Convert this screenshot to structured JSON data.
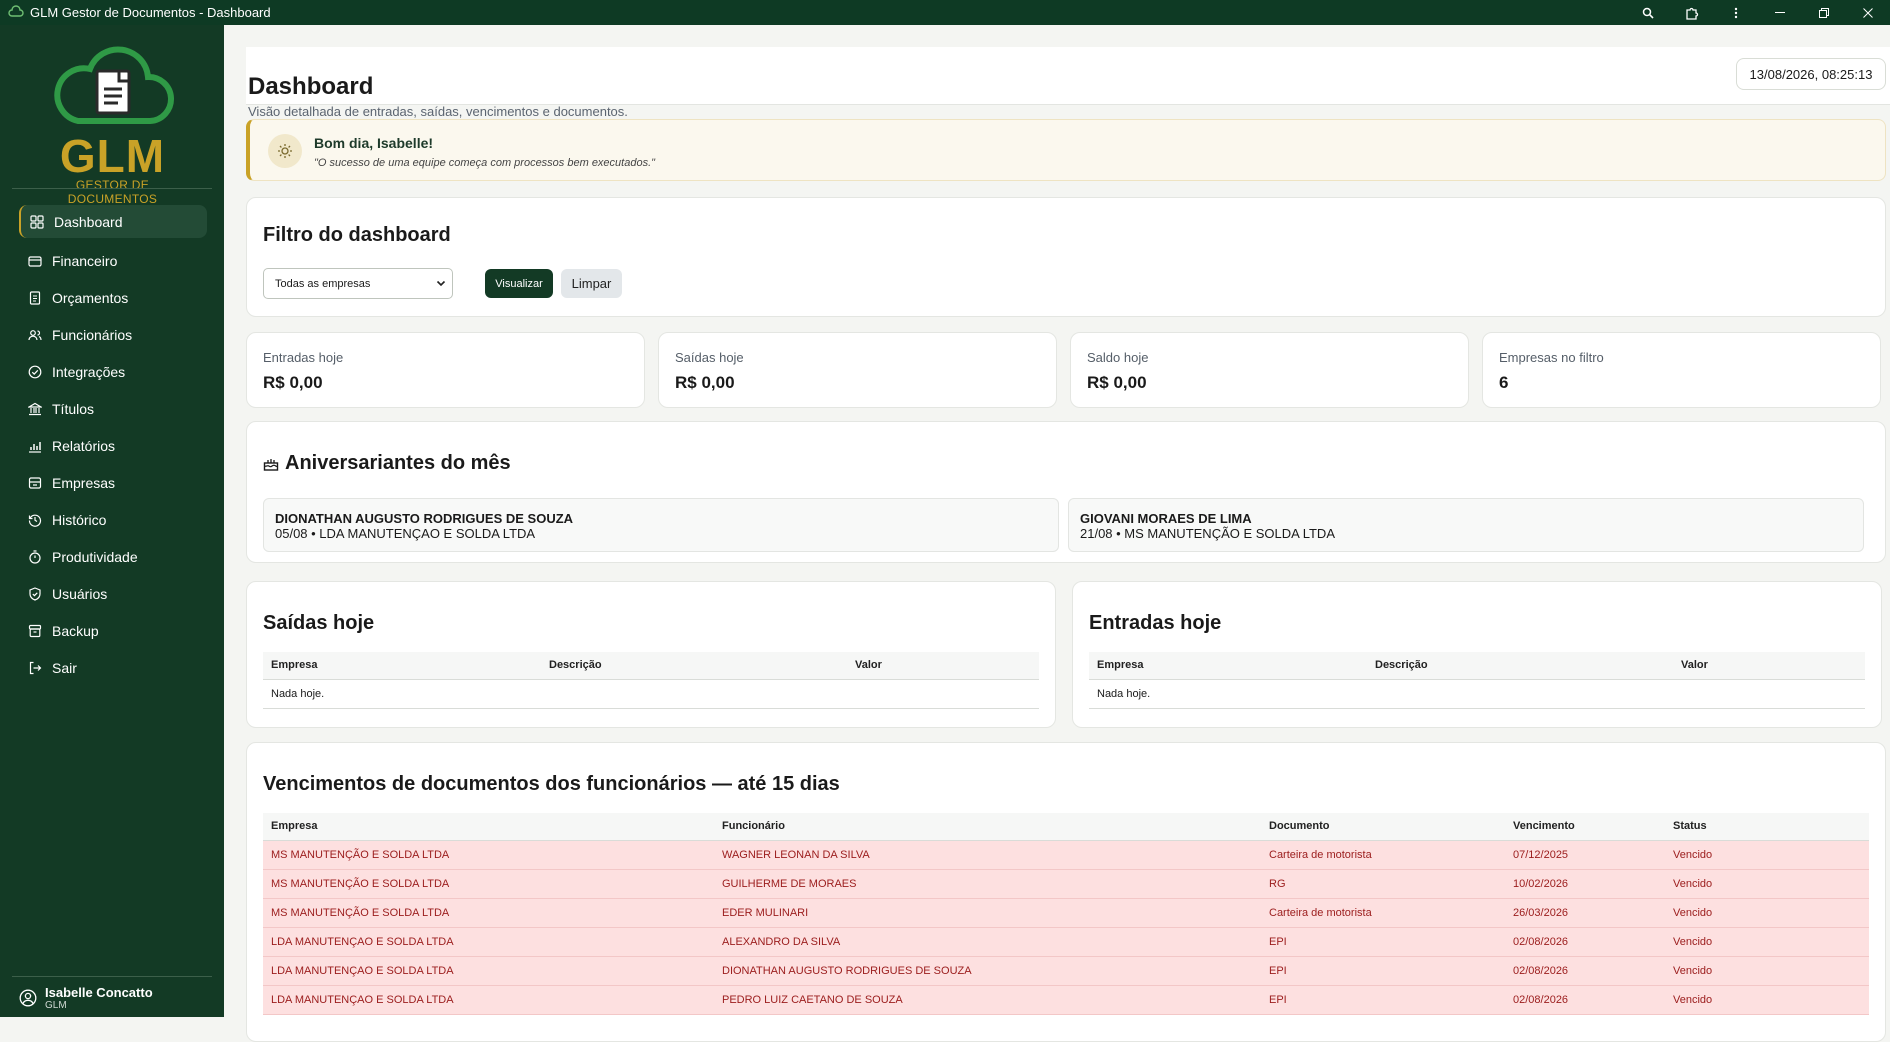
{
  "window": {
    "title": "GLM Gestor de Documentos - Dashboard"
  },
  "sidebar": {
    "logo_text": "GLM",
    "logo_sub": "GESTOR DE DOCUMENTOS",
    "items": [
      {
        "label": "Dashboard",
        "icon": "grid-icon"
      },
      {
        "label": "Financeiro",
        "icon": "wallet-icon"
      },
      {
        "label": "Orçamentos",
        "icon": "file-icon"
      },
      {
        "label": "Funcionários",
        "icon": "users-icon"
      },
      {
        "label": "Integrações",
        "icon": "check-circle-icon"
      },
      {
        "label": "Títulos",
        "icon": "bank-icon"
      },
      {
        "label": "Relatórios",
        "icon": "chart-icon"
      },
      {
        "label": "Empresas",
        "icon": "building-icon"
      },
      {
        "label": "Histórico",
        "icon": "history-icon"
      },
      {
        "label": "Produtividade",
        "icon": "stopwatch-icon"
      },
      {
        "label": "Usuários",
        "icon": "shield-icon"
      },
      {
        "label": "Backup",
        "icon": "archive-icon"
      },
      {
        "label": "Sair",
        "icon": "logout-icon"
      }
    ],
    "user": {
      "name": "Isabelle Concatto",
      "company": "GLM"
    }
  },
  "header": {
    "title": "Dashboard",
    "subtitle": "Visão detalhada de entradas, saídas, vencimentos e documentos.",
    "datetime": "13/08/2026, 08:25:13"
  },
  "greeting": {
    "title": "Bom dia, Isabelle!",
    "quote": "\"O sucesso de uma equipe começa com processos bem executados.\""
  },
  "filter": {
    "title": "Filtro do dashboard",
    "select_value": "Todas as empresas",
    "view_label": "Visualizar",
    "clear_label": "Limpar"
  },
  "stats": [
    {
      "label": "Entradas hoje",
      "value": "R$ 0,00"
    },
    {
      "label": "Saídas hoje",
      "value": "R$ 0,00"
    },
    {
      "label": "Saldo hoje",
      "value": "R$ 0,00"
    },
    {
      "label": "Empresas no filtro",
      "value": "6"
    }
  ],
  "birthdays": {
    "title": "Aniversariantes do mês",
    "items": [
      {
        "name": "DIONATHAN AUGUSTO RODRIGUES DE SOUZA",
        "detail": "05/08 • LDA MANUTENÇAO E SOLDA LTDA"
      },
      {
        "name": "GIOVANI MORAES DE LIMA",
        "detail": "21/08 • MS MANUTENÇÃO E SOLDA LTDA"
      }
    ]
  },
  "outflows": {
    "title": "Saídas hoje",
    "columns": [
      "Empresa",
      "Descrição",
      "Valor"
    ],
    "empty": "Nada hoje."
  },
  "inflows": {
    "title": "Entradas hoje",
    "columns": [
      "Empresa",
      "Descrição",
      "Valor"
    ],
    "empty": "Nada hoje."
  },
  "expirations": {
    "title": "Vencimentos de documentos dos funcionários — até 15 dias",
    "columns": [
      "Empresa",
      "Funcionário",
      "Documento",
      "Vencimento",
      "Status"
    ],
    "rows": [
      [
        "MS MANUTENÇÃO E SOLDA LTDA",
        "WAGNER LEONAN DA SILVA",
        "Carteira de motorista",
        "07/12/2025",
        "Vencido"
      ],
      [
        "MS MANUTENÇÃO E SOLDA LTDA",
        "GUILHERME DE MORAES",
        "RG",
        "10/02/2026",
        "Vencido"
      ],
      [
        "MS MANUTENÇÃO E SOLDA LTDA",
        "EDER MULINARI",
        "Carteira de motorista",
        "26/03/2026",
        "Vencido"
      ],
      [
        "LDA MANUTENÇAO E SOLDA LTDA",
        "ALEXANDRO DA SILVA",
        "EPI",
        "02/08/2026",
        "Vencido"
      ],
      [
        "LDA MANUTENÇAO E SOLDA LTDA",
        "DIONATHAN AUGUSTO RODRIGUES DE SOUZA",
        "EPI",
        "02/08/2026",
        "Vencido"
      ],
      [
        "LDA MANUTENÇAO E SOLDA LTDA",
        "PEDRO LUIZ CAETANO DE SOUZA",
        "EPI",
        "02/08/2026",
        "Vencido"
      ]
    ]
  },
  "colors": {
    "sidebar": "#133a25",
    "accent_gold": "#c9a227",
    "danger_bg": "#fde0e0",
    "danger_text": "#9b1c1c"
  }
}
